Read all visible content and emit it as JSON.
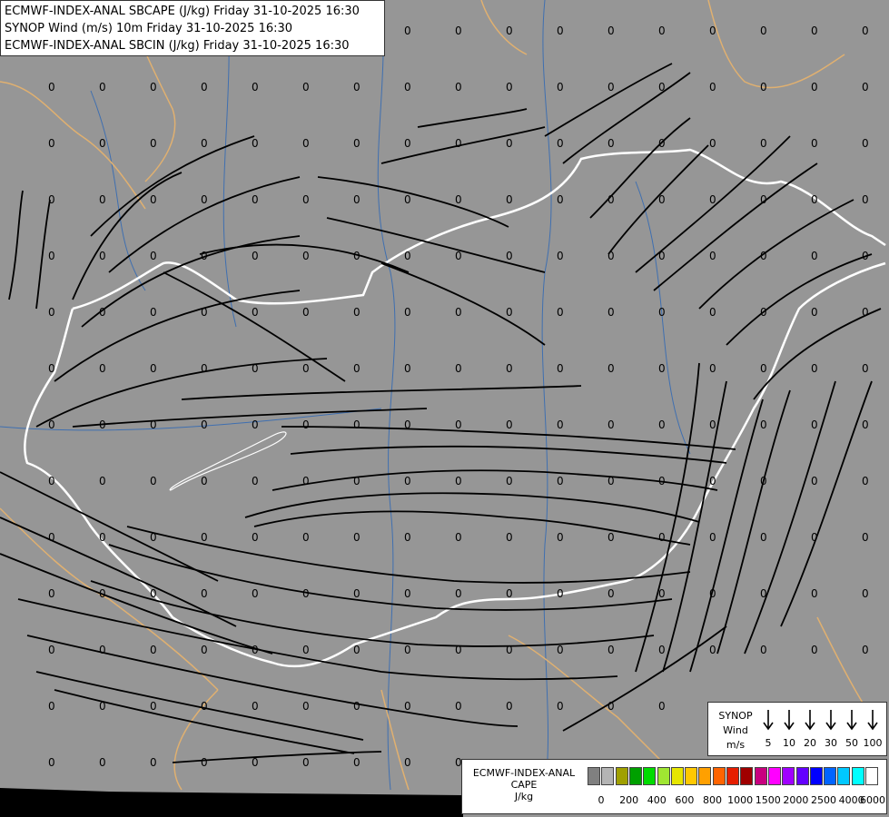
{
  "titles": [
    "ECMWF-INDEX-ANAL SBCAPE (J/kg) Friday 31-10-2025 16:30",
    "SYNOP Wind (m/s) 10m Friday 31-10-2025 16:30",
    "ECMWF-INDEX-ANAL SBCIN (J/kg) Friday 31-10-2025 16:30"
  ],
  "colors": {
    "background": "#969696",
    "streamline": "#000000",
    "river": "#3f6fb0",
    "border_country": "#e0b070",
    "border_highlight": "#ffffff",
    "sea_strip": "#000000"
  },
  "field_value_label": "0",
  "wind_legend": {
    "lines": [
      "SYNOP",
      "Wind",
      "m/s"
    ],
    "values": [
      "5",
      "10",
      "20",
      "30",
      "50",
      "100"
    ]
  },
  "cape_legend": {
    "lines": [
      "ECMWF-INDEX-ANAL",
      "CAPE",
      "J/kg"
    ],
    "swatch_colors": [
      "#808080",
      "#b4b4b4",
      "#a0a000",
      "#00a000",
      "#00dc00",
      "#a0e632",
      "#e6e600",
      "#ffc800",
      "#ffa000",
      "#ff6400",
      "#e61e00",
      "#a00000",
      "#c8007f",
      "#ff00ff",
      "#a000ff",
      "#6400ff",
      "#0000ff",
      "#0064ff",
      "#00c8ff",
      "#00ffff",
      "#ffffff"
    ],
    "ticks": [
      "0",
      "200",
      "400",
      "600",
      "800",
      "1000",
      "1500",
      "2000",
      "2500",
      "4000",
      "6000"
    ]
  }
}
